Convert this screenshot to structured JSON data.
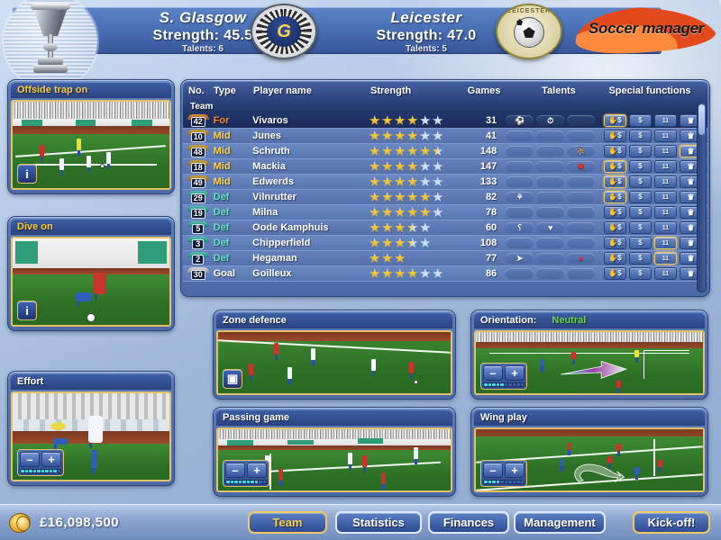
{
  "header": {
    "home": {
      "name": "S. Glasgow",
      "strength": "Strength: 45.5",
      "talents": "Talents: 6"
    },
    "away": {
      "name": "Leicester",
      "strength": "Strength: 47.0",
      "talents": "Talents: 5"
    },
    "home_crest_mark": "G",
    "away_crest_text": "LEICESTER",
    "logo": "Soccer manager"
  },
  "left_panels": [
    {
      "title": "Offside trap on",
      "control": "info"
    },
    {
      "title": "Dive on",
      "control": "info"
    },
    {
      "title": "Effort",
      "control": "stepper",
      "minus": "–",
      "plus": "+",
      "level": 9,
      "level_max": 10
    }
  ],
  "tactic_panels": [
    {
      "title": "Zone defence",
      "control": "toggle"
    },
    {
      "title": "Orientation:",
      "value": "Neutral",
      "control": "stepper",
      "minus": "–",
      "plus": "+",
      "level": 5,
      "level_max": 10
    },
    {
      "title": "Passing game",
      "control": "stepper",
      "minus": "–",
      "plus": "+",
      "level": 8,
      "level_max": 10
    },
    {
      "title": "Wing play",
      "control": "stepper",
      "minus": "–",
      "plus": "+",
      "level": 4,
      "level_max": 10
    }
  ],
  "table": {
    "columns": [
      "No.",
      "Type",
      "Player name",
      "Strength",
      "Games",
      "Talents",
      "Special functions"
    ],
    "group_label": "Team",
    "function_icons": [
      "transfer-hand-money",
      "sell-money",
      "lineup-11",
      "captain-crown"
    ],
    "rows": [
      {
        "no": "42",
        "type": "For",
        "name": "Vivaros",
        "stars": 4,
        "games": "31",
        "talents": [
          "boots",
          "stopwatch",
          ""
        ],
        "fn_highlight": [
          true,
          false,
          false,
          false
        ],
        "selected": true
      },
      {
        "no": "10",
        "type": "Mid",
        "name": "Junes",
        "stars": 4,
        "games": "41",
        "talents": [
          "",
          "",
          ""
        ],
        "fn_highlight": [
          false,
          false,
          false,
          false
        ],
        "selected": false
      },
      {
        "no": "48",
        "type": "Mid",
        "name": "Schruth",
        "stars": 5.5,
        "games": "148",
        "talents": [
          "",
          "",
          "red-figure"
        ],
        "fn_highlight": [
          false,
          false,
          false,
          true
        ],
        "selected": false
      },
      {
        "no": "18",
        "type": "Mid",
        "name": "Mackia",
        "stars": 4,
        "games": "147",
        "talents": [
          "",
          "",
          "red-burst"
        ],
        "fn_highlight": [
          true,
          false,
          false,
          false
        ],
        "selected": false
      },
      {
        "no": "49",
        "type": "Mid",
        "name": "Edwerds",
        "stars": 4,
        "games": "133",
        "talents": [
          "",
          "",
          ""
        ],
        "fn_highlight": [
          true,
          false,
          false,
          false
        ],
        "selected": false
      },
      {
        "no": "29",
        "type": "Def",
        "name": "Vilnrutter",
        "stars": 5,
        "games": "82",
        "talents": [
          "bird",
          "",
          ""
        ],
        "fn_highlight": [
          true,
          false,
          false,
          false
        ],
        "selected": false
      },
      {
        "no": "19",
        "type": "Def",
        "name": "Milna",
        "stars": 5,
        "games": "78",
        "talents": [
          "",
          "",
          ""
        ],
        "fn_highlight": [
          false,
          false,
          false,
          false
        ],
        "selected": false
      },
      {
        "no": "5",
        "type": "Def",
        "name": "Oode Kamphuis",
        "stars": 3.5,
        "games": "60",
        "talents": [
          "cane",
          "heart",
          ""
        ],
        "fn_highlight": [
          false,
          false,
          false,
          false
        ],
        "selected": false
      },
      {
        "no": "3",
        "type": "Def",
        "name": "Chipperfield",
        "stars": 3.5,
        "games": "108",
        "talents": [
          "",
          "",
          ""
        ],
        "fn_highlight": [
          false,
          false,
          true,
          false
        ],
        "selected": false
      },
      {
        "no": "2",
        "type": "Def",
        "name": "Hegaman",
        "stars": 3,
        "games": "77",
        "talents": [
          "dart",
          "",
          "red-drop"
        ],
        "fn_highlight": [
          false,
          false,
          true,
          false
        ],
        "selected": false
      },
      {
        "no": "30",
        "type": "Goal",
        "name": "Goilleux",
        "stars": 4,
        "games": "86",
        "talents": [
          "",
          "",
          ""
        ],
        "fn_highlight": [
          false,
          false,
          false,
          false
        ],
        "selected": false
      }
    ]
  },
  "bottom": {
    "money": "£16,098,500",
    "tabs": [
      {
        "label": "Team",
        "active": true
      },
      {
        "label": "Statistics",
        "active": false
      },
      {
        "label": "Finances",
        "active": false
      },
      {
        "label": "Management",
        "active": false
      }
    ],
    "kickoff": "Kick-off!"
  }
}
